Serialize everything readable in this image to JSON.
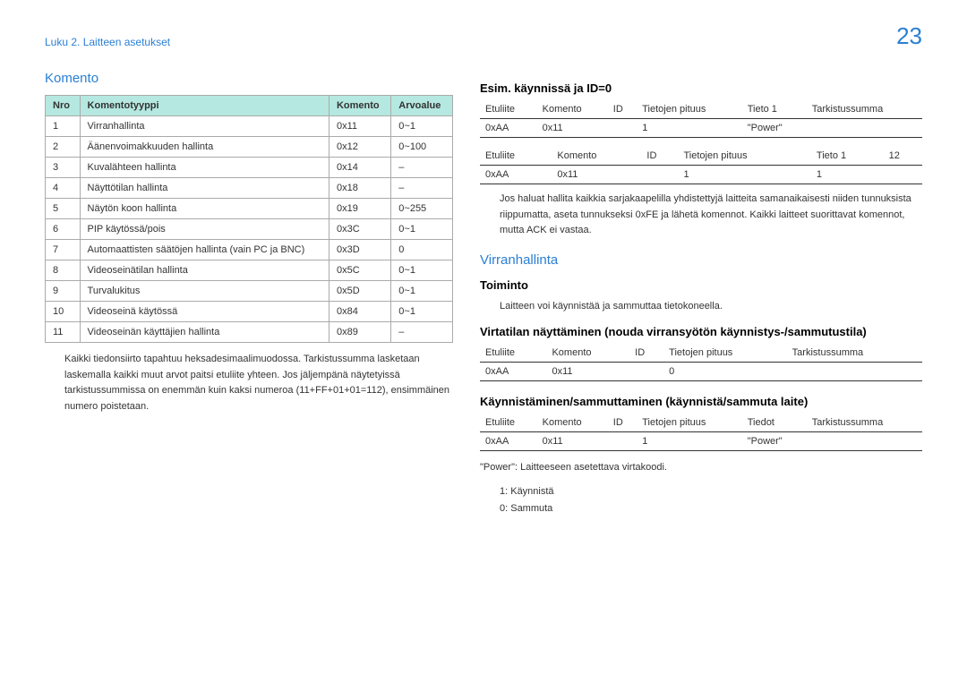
{
  "page_number": "23",
  "chapter": "Luku 2. Laitteen asetukset",
  "left": {
    "title": "Komento",
    "headers": [
      "Nro",
      "Komentotyyppi",
      "Komento",
      "Arvoalue"
    ],
    "rows": [
      [
        "1",
        "Virranhallinta",
        "0x11",
        "0~1"
      ],
      [
        "2",
        "Äänenvoimakkuuden hallinta",
        "0x12",
        "0~100"
      ],
      [
        "3",
        "Kuvalähteen hallinta",
        "0x14",
        "–"
      ],
      [
        "4",
        "Näyttötilan hallinta",
        "0x18",
        "–"
      ],
      [
        "5",
        "Näytön koon hallinta",
        "0x19",
        "0~255"
      ],
      [
        "6",
        "PIP käytössä/pois",
        "0x3C",
        "0~1"
      ],
      [
        "7",
        "Automaattisten säätöjen hallinta (vain PC ja BNC)",
        "0x3D",
        "0"
      ],
      [
        "8",
        "Videoseinätilan hallinta",
        "0x5C",
        "0~1"
      ],
      [
        "9",
        "Turvalukitus",
        "0x5D",
        "0~1"
      ],
      [
        "10",
        "Videoseinä käytössä",
        "0x84",
        "0~1"
      ],
      [
        "11",
        "Videoseinän käyttäjien hallinta",
        "0x89",
        "–"
      ]
    ],
    "paragraph": "Kaikki tiedonsiirto tapahtuu heksadesimaalimuodossa. Tarkistussumma lasketaan laskemalla kaikki muut arvot paitsi etuliite yhteen. Jos jäljempänä näytetyissä tarkistussummissa on enemmän kuin kaksi numeroa (11+FF+01+01=112), ensimmäinen numero poistetaan."
  },
  "right": {
    "example_title": "Esim. käynnissä ja ID=0",
    "packet_headers": [
      "Etuliite",
      "Komento",
      "ID",
      "Tietojen pituus",
      "Tieto 1",
      "Tarkistussumma"
    ],
    "packet1_row": [
      "0xAA",
      "0x11",
      "",
      "1",
      "\"Power\"",
      ""
    ],
    "packet2_headers": [
      "Etuliite",
      "Komento",
      "ID",
      "Tietojen pituus",
      "Tieto 1",
      "12"
    ],
    "packet2_row": [
      "0xAA",
      "0x11",
      "",
      "1",
      "1",
      ""
    ],
    "note": "Jos haluat hallita kaikkia sarjakaapelilla yhdistettyjä laitteita samanaikaisesti niiden tunnuksista riippumatta, aseta tunnukseksi 0xFE ja lähetä komennot. Kaikki laitteet suorittavat komennot, mutta ACK ei vastaa.",
    "section2_title": "Virranhallinta",
    "toiminto_label": "Toiminto",
    "toiminto_text": "Laitteen voi käynnistää ja sammuttaa tietokoneella.",
    "view_title": "Virtatilan näyttäminen (nouda virransyötön käynnistys-/sammutustila)",
    "view_headers": [
      "Etuliite",
      "Komento",
      "ID",
      "Tietojen pituus",
      "Tarkistussumma"
    ],
    "view_row": [
      "0xAA",
      "0x11",
      "",
      "0",
      ""
    ],
    "onoff_title": "Käynnistäminen/sammuttaminen (käynnistä/sammuta laite)",
    "onoff_headers": [
      "Etuliite",
      "Komento",
      "ID",
      "Tietojen pituus",
      "Tiedot",
      "Tarkistussumma"
    ],
    "onoff_row": [
      "0xAA",
      "0x11",
      "",
      "1",
      "\"Power\"",
      ""
    ],
    "power_note": "\"Power\": Laitteeseen asetettava virtakoodi.",
    "power_on": "1: Käynnistä",
    "power_off": "0: Sammuta"
  }
}
